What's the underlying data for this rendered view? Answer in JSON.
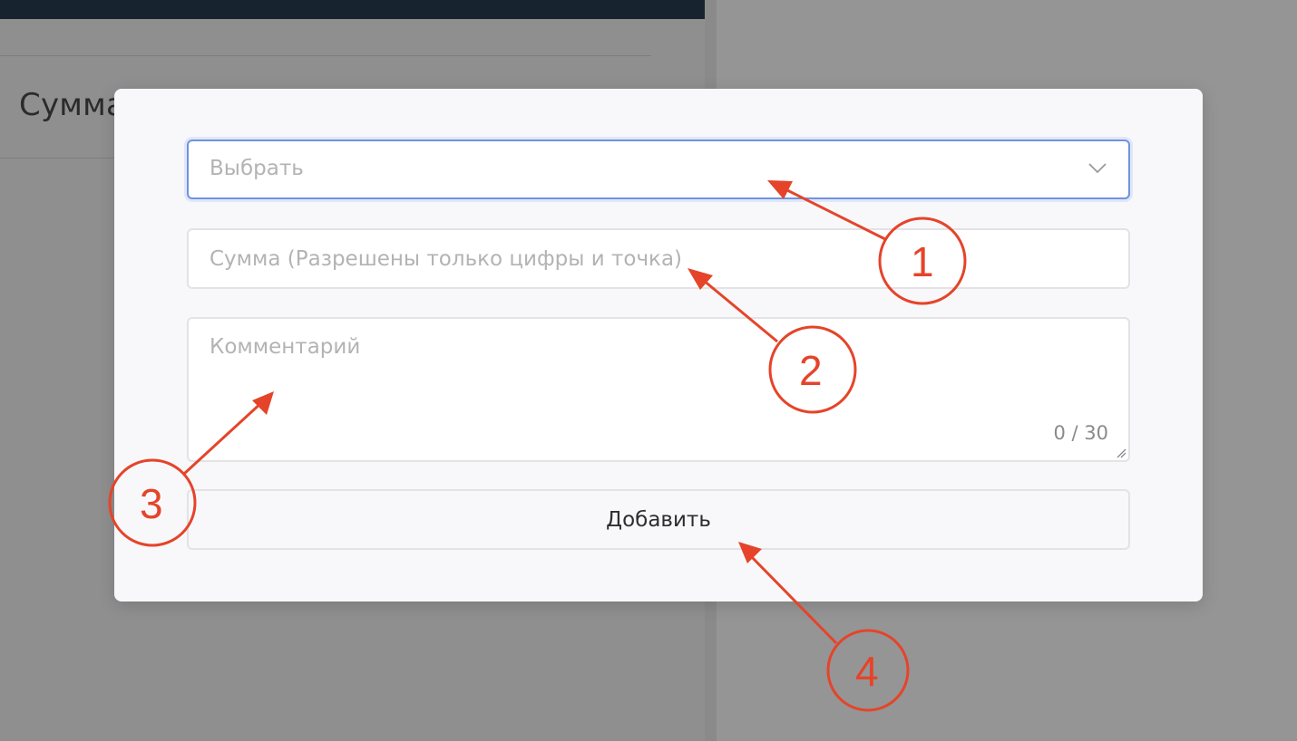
{
  "background": {
    "heading": "Сумма"
  },
  "modal": {
    "select_placeholder": "Выбрать",
    "amount_placeholder": "Сумма (Разрешены только цифры и точка)",
    "comment_placeholder": "Комментарий",
    "comment_counter": "0 / 30",
    "add_button_label": "Добавить"
  },
  "annotations": {
    "markers": [
      "1",
      "2",
      "3",
      "4"
    ],
    "color": "#e5442a"
  }
}
